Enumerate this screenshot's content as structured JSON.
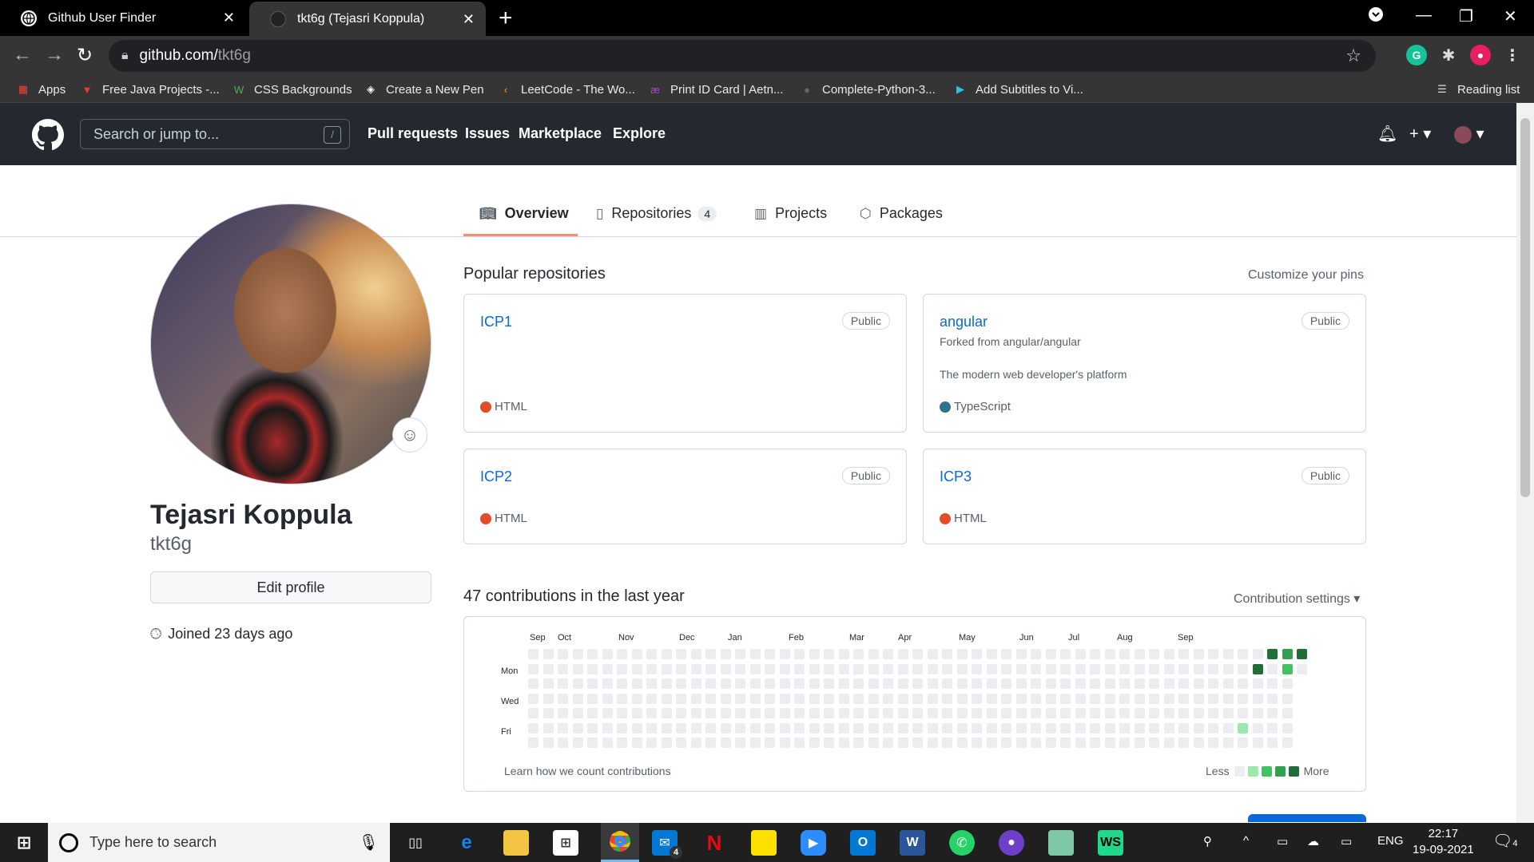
{
  "browser": {
    "tabs": [
      {
        "title": "Github User Finder",
        "active": false
      },
      {
        "title": "tkt6g (Tejasri Koppula)",
        "active": true
      }
    ],
    "url_host": "github.com/",
    "url_path": "tkt6g",
    "bookmarks": [
      {
        "label": "Apps",
        "icon": "apps-grid-icon",
        "color": "#ea4335"
      },
      {
        "label": "Free Java Projects -...",
        "icon": "triangle-logo-icon",
        "color": "#e53935"
      },
      {
        "label": "CSS Backgrounds",
        "icon": "w-logo-icon",
        "color": "#4caf50"
      },
      {
        "label": "Create a New Pen",
        "icon": "codepen-icon",
        "color": "#ffffff"
      },
      {
        "label": "LeetCode - The Wo...",
        "icon": "leetcode-icon",
        "color": "#f89f1b"
      },
      {
        "label": "Print ID Card | Aetn...",
        "icon": "aetna-logo-icon",
        "color": "#a347d1"
      },
      {
        "label": "Complete-Python-3...",
        "icon": "github-icon",
        "color": "#444444"
      },
      {
        "label": "Add Subtitles to Vi...",
        "icon": "play-triangle-icon",
        "color": "#26c6da"
      }
    ],
    "reading_list": "Reading list"
  },
  "github": {
    "search_placeholder": "Search or jump to...",
    "search_shortcut": "/",
    "nav": [
      "Pull requests",
      "Issues",
      "Marketplace",
      "Explore"
    ]
  },
  "profile_tabs": [
    {
      "label": "Overview",
      "icon": "book-icon",
      "count": null
    },
    {
      "label": "Repositories",
      "icon": "repo-icon",
      "count": "4"
    },
    {
      "label": "Projects",
      "icon": "project-board-icon",
      "count": null
    },
    {
      "label": "Packages",
      "icon": "package-icon",
      "count": null
    }
  ],
  "profile": {
    "full_name": "Tejasri Koppula",
    "username": "tkt6g",
    "edit_button": "Edit profile",
    "joined": "Joined 23 days ago"
  },
  "popular": {
    "title": "Popular repositories",
    "customize": "Customize your pins",
    "repos": [
      {
        "name": "ICP1",
        "visibility": "Public",
        "fork": "",
        "description": "",
        "language": "HTML",
        "lang_color": "#e34c26"
      },
      {
        "name": "angular",
        "visibility": "Public",
        "fork": "Forked from angular/angular",
        "description": "The modern web developer's platform",
        "language": "TypeScript",
        "lang_color": "#2b7489"
      },
      {
        "name": "ICP2",
        "visibility": "Public",
        "fork": "",
        "description": "",
        "language": "HTML",
        "lang_color": "#e34c26"
      },
      {
        "name": "ICP3",
        "visibility": "Public",
        "fork": "",
        "description": "",
        "language": "HTML",
        "lang_color": "#e34c26"
      }
    ]
  },
  "contributions": {
    "title": "47 contributions in the last year",
    "settings": "Contribution settings",
    "months": [
      "Sep",
      "Oct",
      "Nov",
      "Dec",
      "Jan",
      "Feb",
      "Mar",
      "Apr",
      "May",
      "Jun",
      "Jul",
      "Aug",
      "Sep"
    ],
    "days": [
      "Mon",
      "Wed",
      "Fri"
    ],
    "learn": "Learn how we count contributions",
    "less": "Less",
    "more": "More",
    "colors": [
      "#ebedf0",
      "#9be9a8",
      "#40c463",
      "#30a14e",
      "#216e39"
    ]
  },
  "taskbar": {
    "search_placeholder": "Type here to search",
    "lang": "ENG",
    "time": "22:17",
    "date": "19-09-2021",
    "notif_count": "4",
    "mail_count": "4"
  }
}
